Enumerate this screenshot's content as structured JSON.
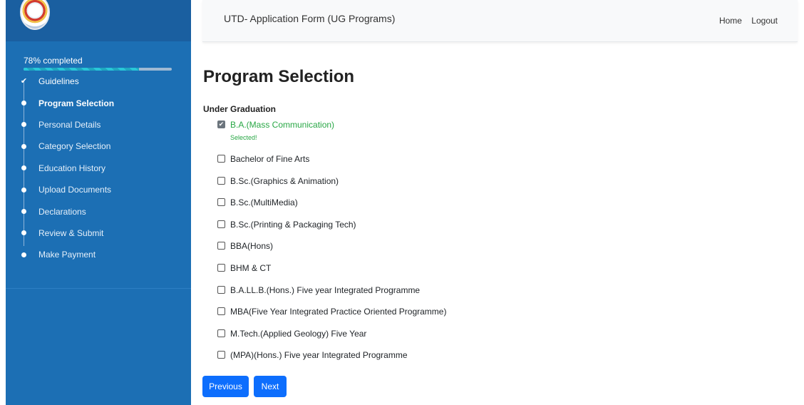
{
  "header": {
    "title": "UTD- Application Form (UG Programs)",
    "nav": {
      "home": "Home",
      "logout": "Logout"
    }
  },
  "sidebar": {
    "logo_icon": "university-seal-icon",
    "progress": {
      "text": "78% completed",
      "percent": 78
    },
    "steps": [
      {
        "label": "Guidelines",
        "state": "done",
        "icon": "check-icon"
      },
      {
        "label": "Program Selection",
        "state": "active",
        "icon": "dot-icon"
      },
      {
        "label": "Personal Details",
        "state": "pending",
        "icon": "dot-icon"
      },
      {
        "label": "Category Selection",
        "state": "pending",
        "icon": "dot-icon"
      },
      {
        "label": "Education History",
        "state": "pending",
        "icon": "dot-icon"
      },
      {
        "label": "Upload Documents",
        "state": "pending",
        "icon": "dot-icon"
      },
      {
        "label": "Declarations",
        "state": "pending",
        "icon": "dot-icon"
      },
      {
        "label": "Review & Submit",
        "state": "pending",
        "icon": "dot-icon"
      },
      {
        "label": "Make Payment",
        "state": "pending",
        "icon": "dot-icon"
      }
    ]
  },
  "main": {
    "page_title": "Program Selection",
    "section_title": "Under Graduation",
    "selected_feedback": "Selected!",
    "options": [
      {
        "label": "B.A.(Mass Communication)",
        "checked": true
      },
      {
        "label": "Bachelor of Fine Arts",
        "checked": false
      },
      {
        "label": "B.Sc.(Graphics & Animation)",
        "checked": false
      },
      {
        "label": "B.Sc.(MultiMedia)",
        "checked": false
      },
      {
        "label": "B.Sc.(Printing & Packaging Tech)",
        "checked": false
      },
      {
        "label": "BBA(Hons)",
        "checked": false
      },
      {
        "label": "BHM & CT",
        "checked": false
      },
      {
        "label": "B.A.LL.B.(Hons.) Five year Integrated Programme",
        "checked": false
      },
      {
        "label": "MBA(Five Year Integrated Practice Oriented Programme)",
        "checked": false
      },
      {
        "label": "M.Tech.(Applied Geology) Five Year",
        "checked": false
      },
      {
        "label": "(MPA)(Hons.) Five year Integrated Programme",
        "checked": false
      }
    ],
    "buttons": {
      "previous": "Previous",
      "next": "Next"
    }
  },
  "colors": {
    "sidebar_bg": "#1c6fb4",
    "primary_button": "#0d6efd",
    "success_text": "#28a745"
  }
}
